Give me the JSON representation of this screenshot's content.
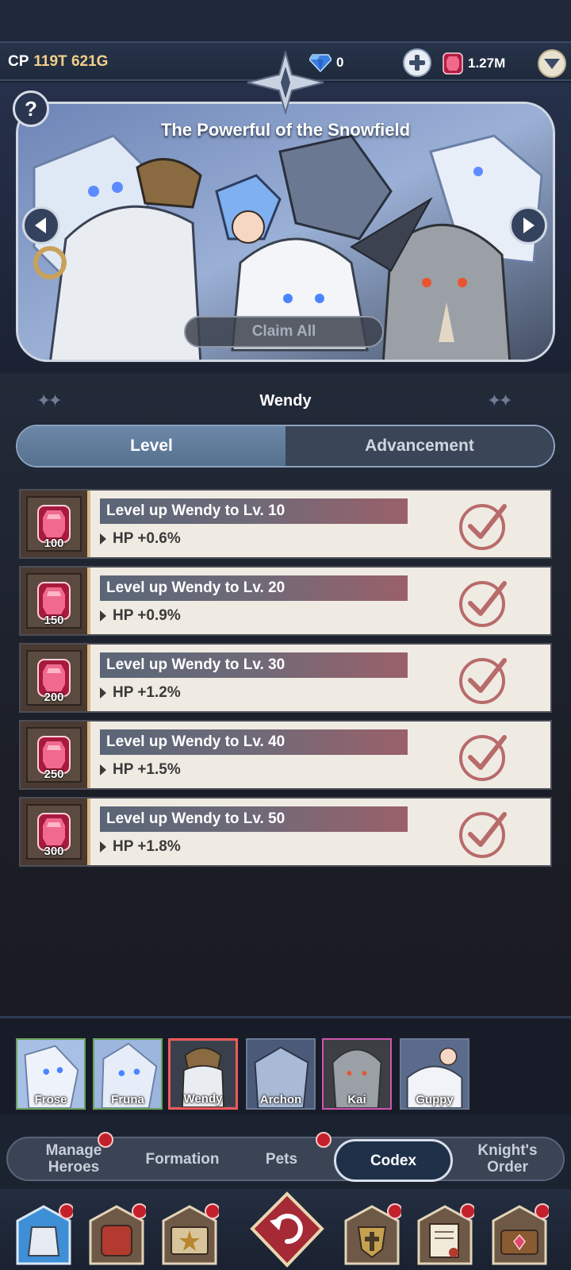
{
  "topbar": {
    "cp_label": "CP",
    "cp_value": "119T 621G",
    "gem_count": "0",
    "ruby_count": "1.27M"
  },
  "banner": {
    "title": "The Powerful of the Snowfield",
    "claim_all": "Claim All",
    "help": "?"
  },
  "hero_name": "Wendy",
  "tabs": [
    {
      "label": "Level",
      "active": true
    },
    {
      "label": "Advancement",
      "active": false
    }
  ],
  "quests": [
    {
      "title": "Level up Wendy to Lv. 10",
      "bonus": "HP +0.6%",
      "reward": "100"
    },
    {
      "title": "Level up Wendy to Lv. 20",
      "bonus": "HP +0.9%",
      "reward": "150"
    },
    {
      "title": "Level up Wendy to Lv. 30",
      "bonus": "HP +1.2%",
      "reward": "200"
    },
    {
      "title": "Level up Wendy to Lv. 40",
      "bonus": "HP +1.5%",
      "reward": "250"
    },
    {
      "title": "Level up Wendy to Lv. 50",
      "bonus": "HP +1.8%",
      "reward": "300"
    }
  ],
  "heroes": [
    {
      "name": "Frose"
    },
    {
      "name": "Fruna"
    },
    {
      "name": "Wendy"
    },
    {
      "name": "Archon"
    },
    {
      "name": "Kai"
    },
    {
      "name": "Guppy"
    }
  ],
  "subnav": [
    {
      "label": "Manage Heroes"
    },
    {
      "label": "Formation"
    },
    {
      "label": "Pets"
    },
    {
      "label": "Codex"
    },
    {
      "label": "Knight's Order"
    }
  ],
  "colors": {
    "accent_gold": "#f3d08a",
    "ruby": "#e0466a",
    "notification": "#c3202b",
    "selected_border": "#ef5a5a"
  }
}
